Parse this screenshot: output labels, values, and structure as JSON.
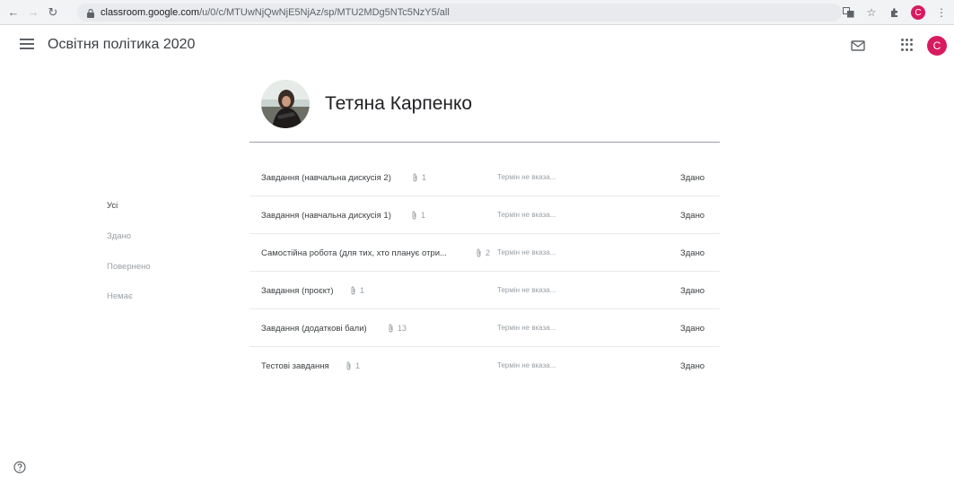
{
  "browser": {
    "url_host": "classroom.google.com",
    "url_path": "/u/0/c/MTUwNjQwNjE5NjAz/sp/MTU2MDg5NTc5NzY5/all",
    "profile_initial": "C"
  },
  "header": {
    "class_title": "Освітня політика 2020",
    "avatar_initial": "C"
  },
  "student": {
    "name": "Тетяна Карпенко"
  },
  "filters": [
    {
      "label": "Усі",
      "active": true
    },
    {
      "label": "Здано",
      "active": false
    },
    {
      "label": "Повернено",
      "active": false
    },
    {
      "label": "Немає",
      "active": false
    }
  ],
  "assignments": [
    {
      "title": "Завдання (навчальна дискусія 2)",
      "attachments": "1",
      "due": "Термін не вказа...",
      "status": "Здано"
    },
    {
      "title": "Завдання (навчальна дискусія 1)",
      "attachments": "1",
      "due": "Термін не вказа...",
      "status": "Здано"
    },
    {
      "title": "Самостійна робота (для тих, хто планує отри...",
      "attachments": "2",
      "due": "Термін не вказа...",
      "status": "Здано"
    },
    {
      "title": "Завдання (проєкт)",
      "attachments": "1",
      "due": "Термін не вказа...",
      "status": "Здано"
    },
    {
      "title": "Завдання (додаткові бали)",
      "attachments": "13",
      "due": "Термін не вказа...",
      "status": "Здано"
    },
    {
      "title": "Тестові завдання",
      "attachments": "1",
      "due": "Термін не вказа...",
      "status": "Здано"
    }
  ],
  "colors": {
    "accent": "#d81b60",
    "divider": "#9aa0a6"
  }
}
